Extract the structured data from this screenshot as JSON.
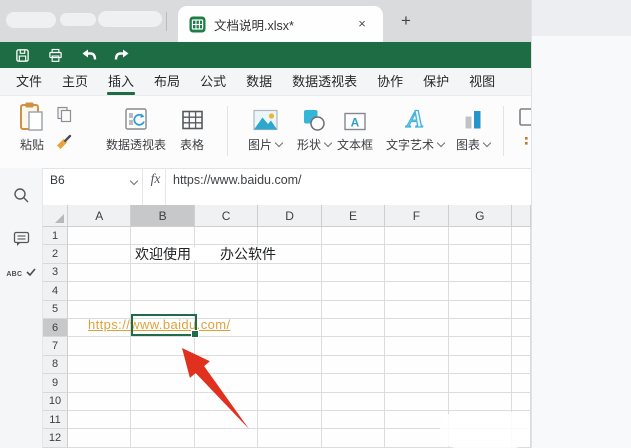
{
  "window": {
    "tab_bar": {
      "tab_title": "文档说明.xlsx*",
      "close_label": "×",
      "new_tab_label": "+"
    },
    "quick_toolbar": {
      "icons": [
        "save",
        "print",
        "undo",
        "redo"
      ]
    },
    "menu": {
      "items": [
        {
          "label": "文件",
          "active": false
        },
        {
          "label": "主页",
          "active": false
        },
        {
          "label": "插入",
          "active": true
        },
        {
          "label": "布局",
          "active": false
        },
        {
          "label": "公式",
          "active": false
        },
        {
          "label": "数据",
          "active": false
        },
        {
          "label": "数据透视表",
          "active": false
        },
        {
          "label": "协作",
          "active": false
        },
        {
          "label": "保护",
          "active": false
        },
        {
          "label": "视图",
          "active": false
        }
      ]
    },
    "ribbon": {
      "paste_label": "粘贴",
      "pivot_label": "数据透视表",
      "table_label": "表格",
      "picture_label": "图片",
      "shapes_label": "形状",
      "textbox_label": "文本框",
      "wordart_label": "文字艺术",
      "chart_label": "图表"
    },
    "formula_bar": {
      "name_box": "B6",
      "fx_label": "fx",
      "formula": "https://www.baidu.com/"
    },
    "sidebar": {
      "spell_glyph": "ABC"
    }
  },
  "grid": {
    "columns": [
      "A",
      "B",
      "C",
      "D",
      "E",
      "F",
      "G"
    ],
    "rows": [
      "1",
      "2",
      "3",
      "4",
      "5",
      "6",
      "7",
      "8",
      "9",
      "10",
      "11",
      "12"
    ],
    "selected_column": "B",
    "selected_row": "6",
    "selected_cell": "B6",
    "cells": {
      "b2_text_prefix": "欢迎使用",
      "b2_text_suffix": "办公软件",
      "a6_hyperlink": "https://www.baidu.com/"
    }
  },
  "colors": {
    "brand_green": "#1e6c43",
    "hyperlink_orange": "#dfa23b",
    "selection_green": "#1f6b4a",
    "arrow_red": "#e0301e"
  }
}
